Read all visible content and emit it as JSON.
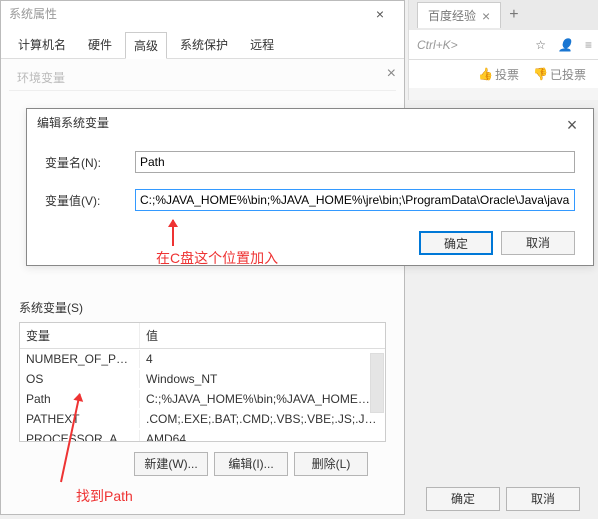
{
  "sysprops": {
    "title": "系统属性",
    "tabs": [
      "计算机名",
      "硬件",
      "高级",
      "系统保护",
      "远程"
    ],
    "active_tab": 2,
    "sub_label": "环境变量"
  },
  "browser": {
    "tab_label": "百度经验",
    "address_hint": "Ctrl+K>",
    "vote_label": "投票",
    "no_label": "已投票"
  },
  "edit_dialog": {
    "title": "编辑系统变量",
    "name_label": "变量名(N):",
    "value_label": "变量值(V):",
    "name_value": "Path",
    "value_value": "C:;%JAVA_HOME%\\bin;%JAVA_HOME%\\jre\\bin;\\ProgramData\\Oracle\\Java\\javapath;%S",
    "ok": "确定",
    "cancel": "取消"
  },
  "sysvars": {
    "group_label": "系统变量(S)",
    "col_name": "变量",
    "col_val": "值",
    "rows": [
      {
        "name": "NUMBER_OF_PR...",
        "val": "4"
      },
      {
        "name": "OS",
        "val": "Windows_NT"
      },
      {
        "name": "Path",
        "val": "C:;%JAVA_HOME%\\bin;%JAVA_HOME%\\..."
      },
      {
        "name": "PATHEXT",
        "val": ".COM;.EXE;.BAT;.CMD;.VBS;.VBE;.JS;.JSE;..."
      },
      {
        "name": "PROCESSOR_AR...",
        "val": "AMD64"
      }
    ],
    "btn_new": "新建(W)...",
    "btn_edit": "编辑(I)...",
    "btn_del": "删除(L)"
  },
  "bottom": {
    "ok": "确定",
    "cancel": "取消"
  },
  "annotations": {
    "insert_note": "在C盘这个位置加入",
    "find_note": "找到Path"
  }
}
